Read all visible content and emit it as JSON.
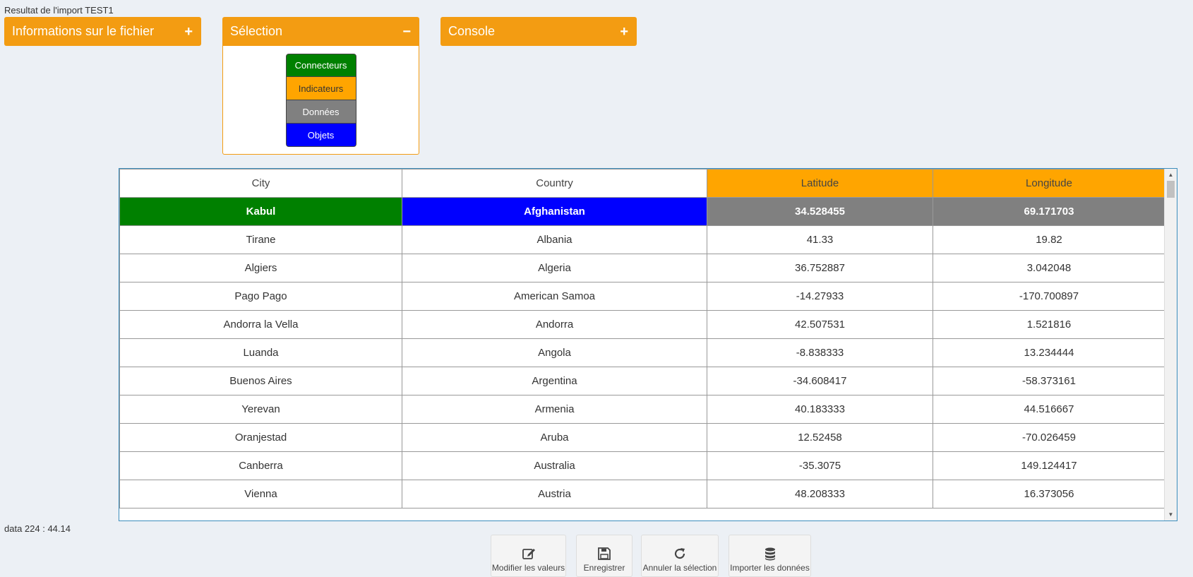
{
  "page": {
    "title": "Resultat de l'import TEST1",
    "status": "data 224 : 44.14"
  },
  "panels": {
    "info": {
      "title": "Informations sur le fichier",
      "toggle": "+"
    },
    "selection": {
      "title": "Sélection",
      "toggle": "−"
    },
    "console": {
      "title": "Console",
      "toggle": "+"
    }
  },
  "selection_buttons": [
    {
      "label": "Connecteurs",
      "bg": "#008000",
      "fg": "#ffffff"
    },
    {
      "label": "Indicateurs",
      "bg": "#ffa500",
      "fg": "#333333"
    },
    {
      "label": "Données",
      "bg": "#808080",
      "fg": "#ffffff"
    },
    {
      "label": "Objets",
      "bg": "#0000ff",
      "fg": "#ffffff"
    }
  ],
  "colors": {
    "accent": "#f39c12",
    "connector": "#008000",
    "indicator": "#ffa500",
    "data": "#808080",
    "object": "#0000ff"
  },
  "table": {
    "headers": [
      "City",
      "Country",
      "Latitude",
      "Longitude"
    ],
    "rows": [
      [
        "Kabul",
        "Afghanistan",
        "34.528455",
        "69.171703"
      ],
      [
        "Tirane",
        "Albania",
        "41.33",
        "19.82"
      ],
      [
        "Algiers",
        "Algeria",
        "36.752887",
        "3.042048"
      ],
      [
        "Pago Pago",
        "American Samoa",
        "-14.27933",
        "-170.700897"
      ],
      [
        "Andorra la Vella",
        "Andorra",
        "42.507531",
        "1.521816"
      ],
      [
        "Luanda",
        "Angola",
        "-8.838333",
        "13.234444"
      ],
      [
        "Buenos Aires",
        "Argentina",
        "-34.608417",
        "-58.373161"
      ],
      [
        "Yerevan",
        "Armenia",
        "40.183333",
        "44.516667"
      ],
      [
        "Oranjestad",
        "Aruba",
        "12.52458",
        "-70.026459"
      ],
      [
        "Canberra",
        "Australia",
        "-35.3075",
        "149.124417"
      ],
      [
        "Vienna",
        "Austria",
        "48.208333",
        "16.373056"
      ]
    ]
  },
  "toolbar": {
    "edit_label": "Modifier les valeurs",
    "save_label": "Enregistrer",
    "cancel_label": "Annuler la sélection",
    "import_label": "Importer les données"
  }
}
